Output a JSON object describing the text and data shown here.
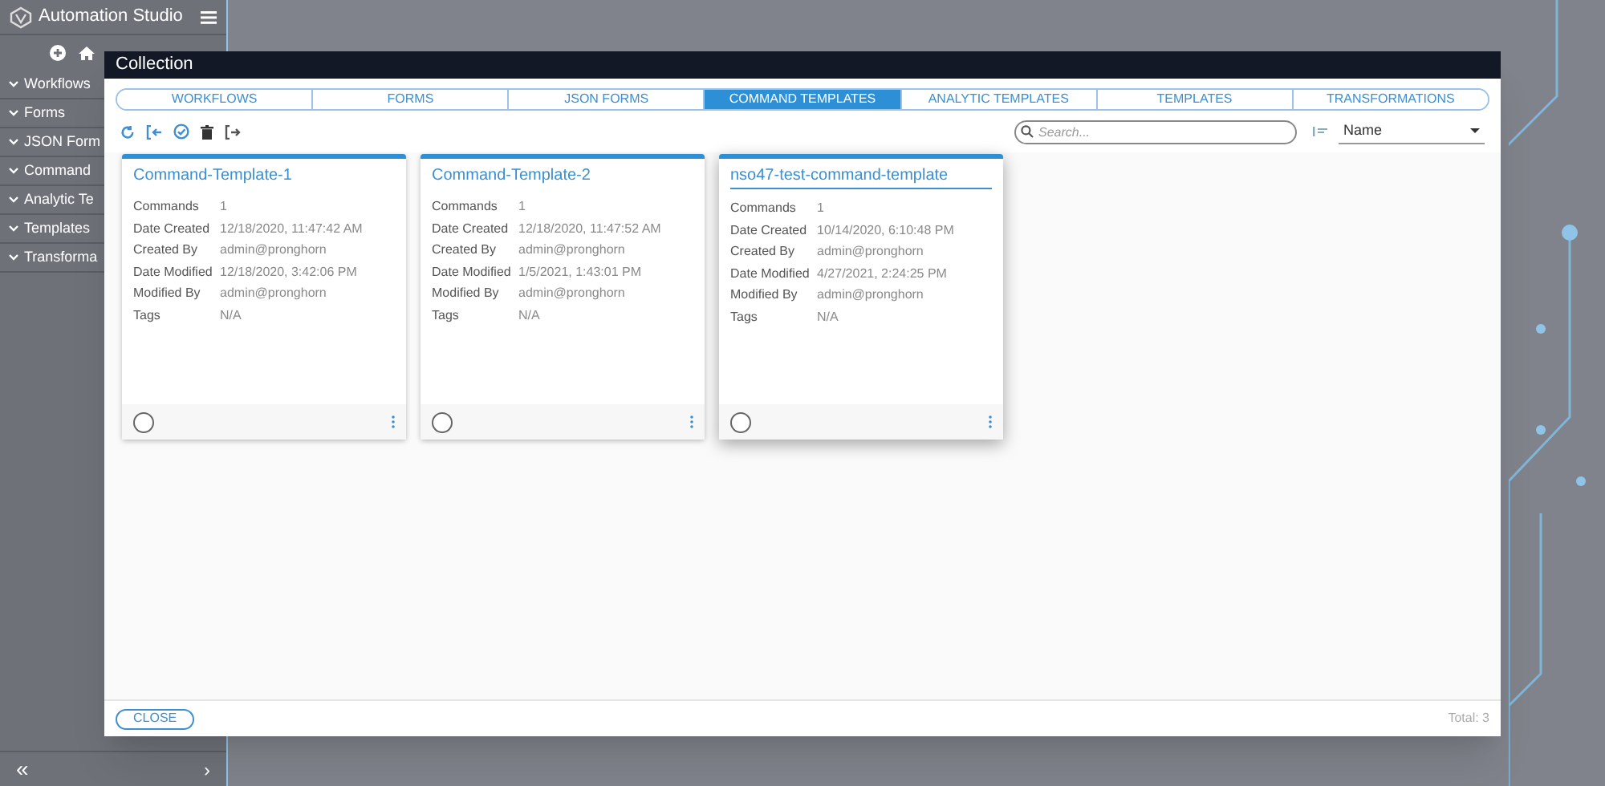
{
  "sidebar": {
    "title": "Automation Studio",
    "items": [
      {
        "label": "Workflows"
      },
      {
        "label": "Forms"
      },
      {
        "label": "JSON Form"
      },
      {
        "label": "Command"
      },
      {
        "label": "Analytic Te"
      },
      {
        "label": "Templates"
      },
      {
        "label": "Transforma"
      }
    ],
    "footer": {
      "collapse": "«",
      "next": "›"
    }
  },
  "modal": {
    "title": "Collection",
    "tabs": [
      {
        "label": "WORKFLOWS",
        "selected": false
      },
      {
        "label": "FORMS",
        "selected": false
      },
      {
        "label": "JSON FORMS",
        "selected": false
      },
      {
        "label": "COMMAND TEMPLATES",
        "selected": true
      },
      {
        "label": "ANALYTIC TEMPLATES",
        "selected": false
      },
      {
        "label": "TEMPLATES",
        "selected": false
      },
      {
        "label": "TRANSFORMATIONS",
        "selected": false
      }
    ],
    "search": {
      "placeholder": "Search..."
    },
    "sort": {
      "value": "Name"
    },
    "cards": [
      {
        "title": "Command-Template-1",
        "hovered": false,
        "selected": false,
        "fields": [
          {
            "label": "Commands",
            "value": "1"
          },
          {
            "label": "Date Created",
            "value": "12/18/2020, 11:47:42 AM"
          },
          {
            "label": "Created By",
            "value": "admin@pronghorn"
          },
          {
            "label": "Date Modified",
            "value": "12/18/2020, 3:42:06 PM"
          },
          {
            "label": "Modified By",
            "value": "admin@pronghorn"
          },
          {
            "label": "Tags",
            "value": "N/A"
          }
        ]
      },
      {
        "title": "Command-Template-2",
        "hovered": false,
        "selected": false,
        "fields": [
          {
            "label": "Commands",
            "value": "1"
          },
          {
            "label": "Date Created",
            "value": "12/18/2020, 11:47:52 AM"
          },
          {
            "label": "Created By",
            "value": "admin@pronghorn"
          },
          {
            "label": "Date Modified",
            "value": "1/5/2021, 1:43:01 PM"
          },
          {
            "label": "Modified By",
            "value": "admin@pronghorn"
          },
          {
            "label": "Tags",
            "value": "N/A"
          }
        ]
      },
      {
        "title": "nso47-test-command-template",
        "hovered": true,
        "selected": false,
        "fields": [
          {
            "label": "Commands",
            "value": "1"
          },
          {
            "label": "Date Created",
            "value": "10/14/2020, 6:10:48 PM"
          },
          {
            "label": "Created By",
            "value": "admin@pronghorn"
          },
          {
            "label": "Date Modified",
            "value": "4/27/2021, 2:24:25 PM"
          },
          {
            "label": "Modified By",
            "value": "admin@pronghorn"
          },
          {
            "label": "Tags",
            "value": "N/A"
          }
        ]
      }
    ],
    "close_button": "CLOSE",
    "total": "Total: 3"
  }
}
